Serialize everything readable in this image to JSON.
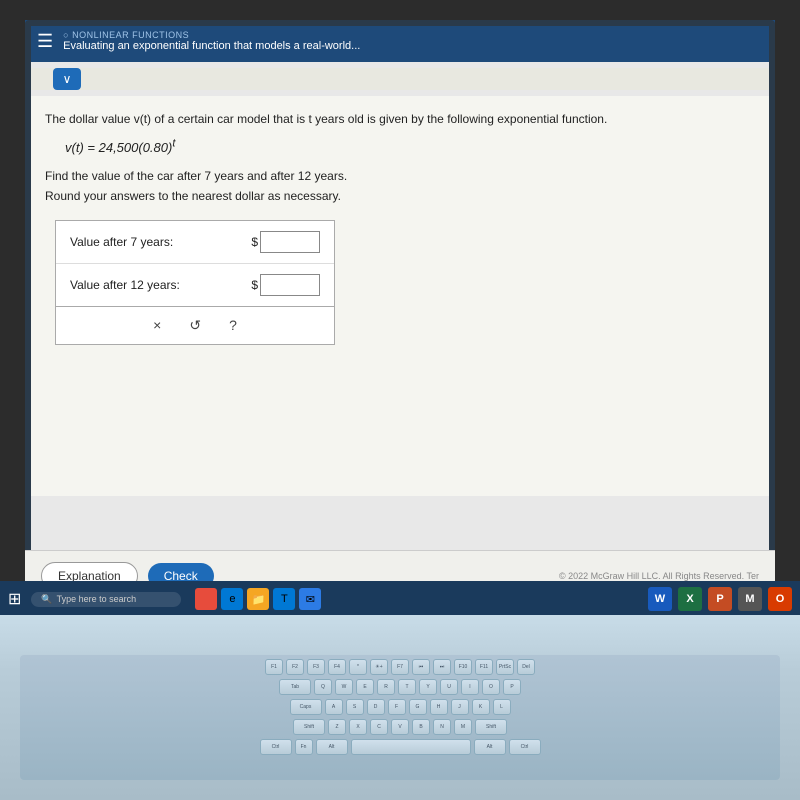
{
  "header": {
    "subtitle": "○ Nonlinear Functions",
    "title": "Evaluating an exponential function that models a real-world..."
  },
  "content": {
    "description": "The dollar value v(t) of a certain car model that is t years old is given by the following exponential function.",
    "formula": "v(t) = 24,500(0.80)",
    "formula_exponent": "t",
    "instructions_line1": "Find the value of the car after 7 years and after 12 years.",
    "instructions_line2": "Round your answers to the nearest dollar as necessary.",
    "input1_label": "Value after 7 years:",
    "input2_label": "Value after 12 years:",
    "dollar_sign": "$",
    "action_x": "×",
    "action_undo": "↺",
    "action_help": "?"
  },
  "bottom": {
    "explanation_label": "Explanation",
    "check_label": "Check",
    "copyright": "© 2022 McGraw Hill LLC. All Rights Reserved.  Ter"
  },
  "taskbar": {
    "search_placeholder": "Type here to search",
    "apps": [
      "W",
      "X",
      "P",
      "M",
      "O"
    ]
  }
}
